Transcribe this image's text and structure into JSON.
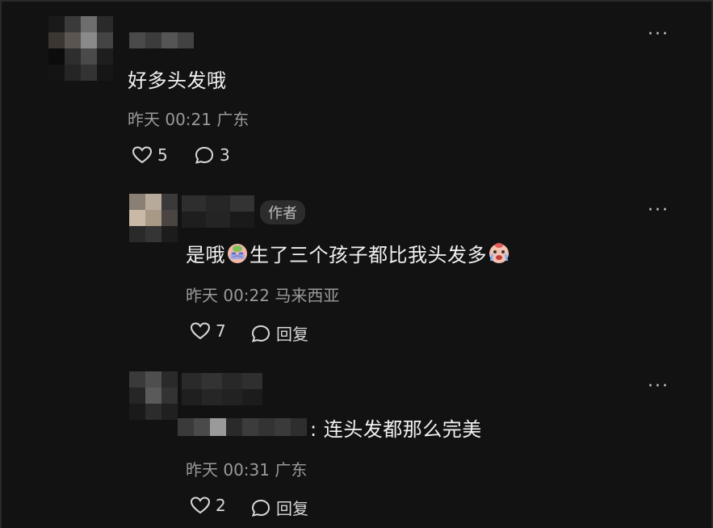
{
  "comments": [
    {
      "text": "好多头发哦",
      "time": "昨天 00:21",
      "location": "广东",
      "likes": "5",
      "replies": "3",
      "more": "···"
    },
    {
      "author_tag": "作者",
      "text_part1": "是哦",
      "text_part2": "生了三个孩子都比我头发多",
      "time": "昨天 00:22",
      "location": "马来西亚",
      "likes": "7",
      "reply_label": "回复",
      "more": "···"
    },
    {
      "text": ": 连头发都那么完美",
      "time": "昨天 00:31",
      "location": "广东",
      "likes": "2",
      "reply_label": "回复",
      "more": "···"
    }
  ],
  "icons": {
    "like": "heart-outline-icon",
    "comment": "speech-bubble-icon",
    "emoji": "crying-face-emoji"
  },
  "colors": {
    "background": "#121212",
    "text": "#f2f2f2",
    "meta": "#9a9a9a"
  }
}
